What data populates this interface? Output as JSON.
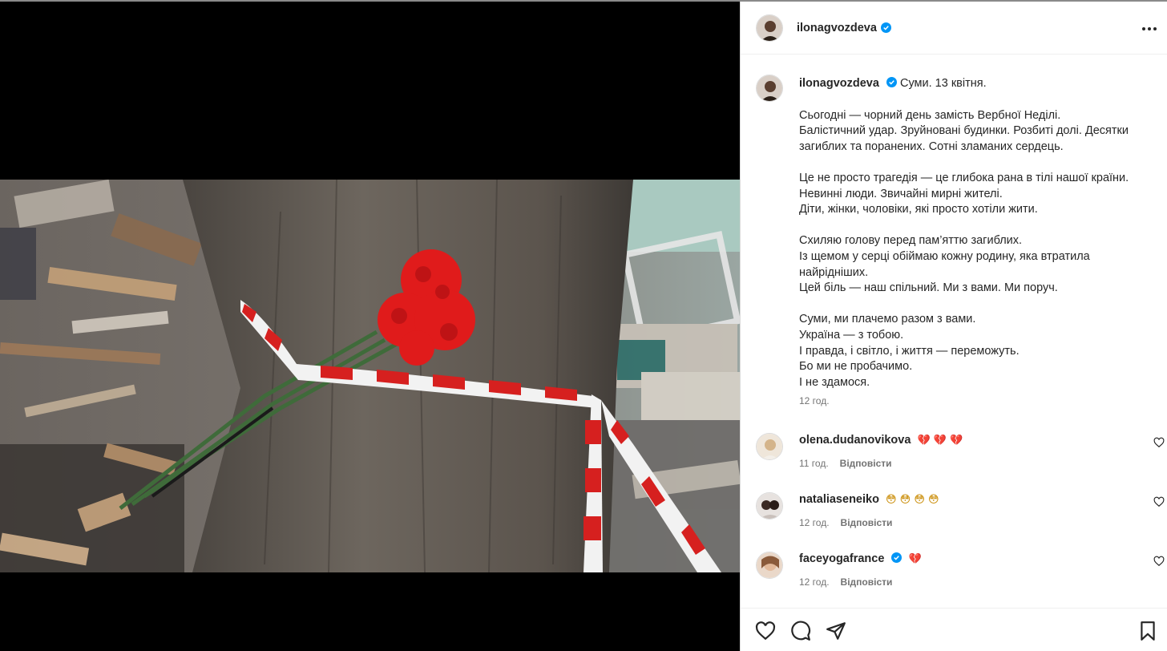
{
  "post": {
    "author": "ilonagvozdeva",
    "caption_location": "Суми. 13 квітня.",
    "caption_lines": "Сьогодні — чорний день замість Вербної Неділі.\nБалістичний удар. Зруйновані будинки. Розбиті долі. Десятки загиблих та поранених. Сотні зламаних сердець.\n\nЦе не просто трагедія — це глибока рана в тілі нашої країни.\nНевинні люди. Звичайні мирні жителі.\nДіти, жінки, чоловіки, які просто хотіли жити.\n\nСхиляю голову перед пам’яттю загиблих.\nІз щемом у серці обіймаю кожну родину, яка втратила найрідніших.\nЦей біль — наш спільний. Ми з вами. Ми поруч.\n\nСуми, ми плачемо разом з вами.\nУкраїна — з тобою.\nІ правда, і світло, і життя — переможуть.\nБо ми не пробачимо.\nІ не здамося.",
    "time": "12 год."
  },
  "comments": [
    {
      "user": "olena.dudanovikova",
      "text": "💔 💔 💔",
      "time": "11 год.",
      "reply": "Відповісти",
      "verified": false
    },
    {
      "user": "nataliaseneiko",
      "text": "😳 😳 😳 😳",
      "time": "12 год.",
      "reply": "Відповісти",
      "verified": false
    },
    {
      "user": "faceyogafrance",
      "text": "💔",
      "time": "12 год.",
      "reply": "Відповісти",
      "verified": true
    }
  ],
  "colors": {
    "verified": "#0095f6",
    "ribbon_red": "#d6201f",
    "flower_red": "#e01b1b"
  },
  "icons": [
    "verified-badge-icon",
    "more-options-icon",
    "heart-icon",
    "comment-icon",
    "share-icon",
    "bookmark-icon"
  ]
}
